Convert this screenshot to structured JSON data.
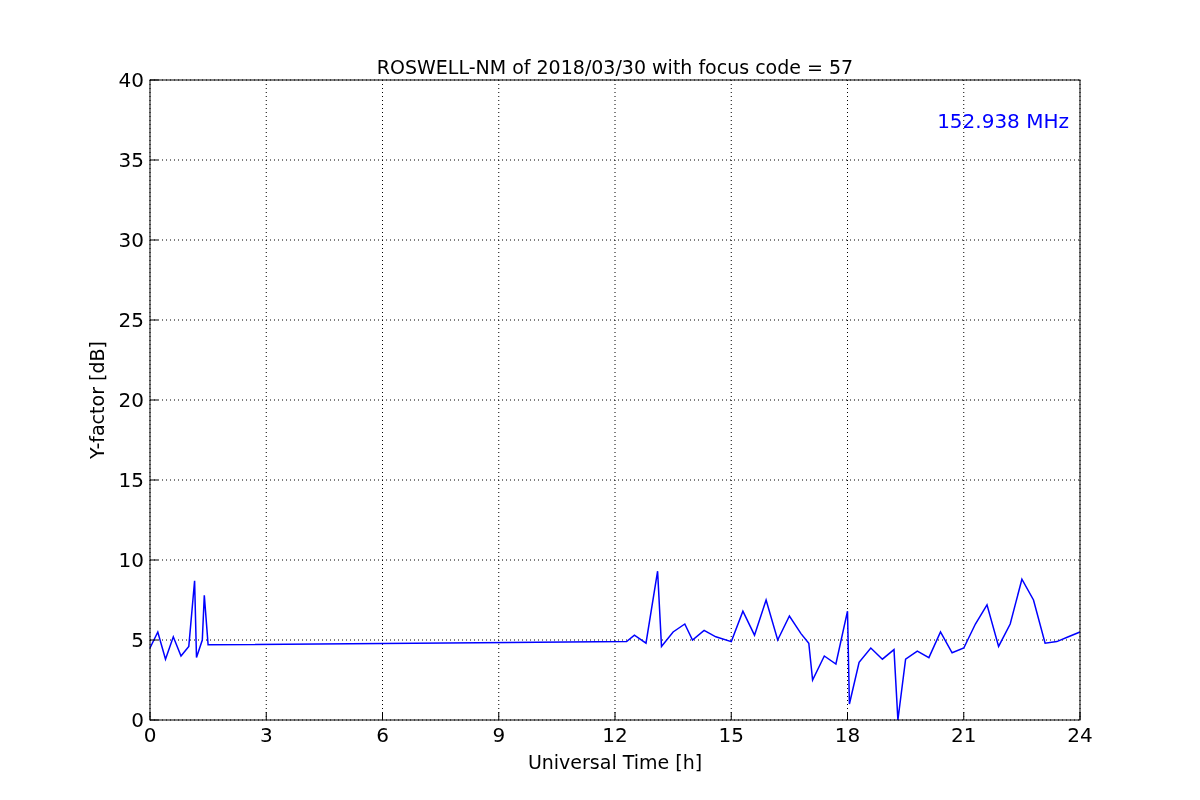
{
  "figure": {
    "chart_data": {
      "type": "line",
      "title": "ROSWELL-NM of 2018/03/30 with focus code = 57",
      "xlabel": "Universal Time [h]",
      "ylabel": "Y-factor [dB]",
      "x": [
        0,
        0.2,
        0.4,
        0.6,
        0.8,
        1.0,
        1.15,
        1.2,
        1.35,
        1.4,
        1.5,
        12.3,
        12.5,
        12.8,
        13.1,
        13.2,
        13.5,
        13.8,
        14.0,
        14.3,
        14.6,
        15.0,
        15.3,
        15.6,
        15.9,
        16.2,
        16.5,
        16.8,
        17.0,
        17.1,
        17.4,
        17.7,
        18.0,
        18.05,
        18.3,
        18.6,
        18.9,
        19.2,
        19.3,
        19.5,
        19.8,
        20.1,
        20.4,
        20.7,
        21.0,
        21.3,
        21.6,
        21.9,
        22.2,
        22.5,
        22.8,
        23.1,
        23.4,
        23.7,
        24.0
      ],
      "series": [
        {
          "color": "#0000ff",
          "values": [
            4.5,
            5.5,
            3.8,
            5.2,
            4.0,
            4.6,
            8.7,
            3.9,
            5.0,
            7.8,
            4.7,
            4.9,
            5.3,
            4.8,
            9.3,
            4.6,
            5.5,
            6.0,
            5.0,
            5.6,
            5.2,
            4.9,
            6.8,
            5.3,
            7.5,
            5.0,
            6.5,
            5.4,
            4.8,
            2.5,
            4.0,
            3.5,
            6.8,
            1.0,
            3.6,
            4.5,
            3.8,
            4.4,
            0,
            3.8,
            4.3,
            3.9,
            5.5,
            4.2,
            4.5,
            6.0,
            7.2,
            4.6,
            6.0,
            8.8,
            7.5,
            4.8,
            4.9,
            5.2,
            5.5
          ]
        }
      ],
      "xlim": [
        0,
        24
      ],
      "ylim": [
        0,
        40
      ],
      "xticks": [
        0,
        3,
        6,
        9,
        12,
        15,
        18,
        21,
        24
      ],
      "yticks": [
        0,
        5,
        10,
        15,
        20,
        25,
        30,
        35,
        40
      ],
      "grid": true,
      "annotations": [
        {
          "text": "152.938 MHz"
        }
      ]
    }
  }
}
